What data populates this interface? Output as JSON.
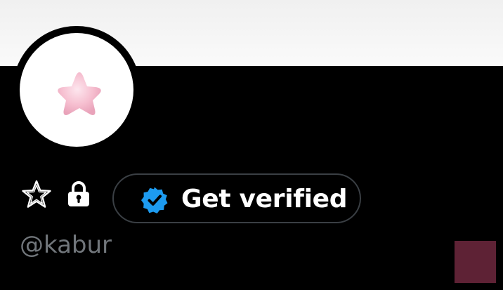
{
  "profile": {
    "handle": "@kabur",
    "verify_button_label": "Get verified"
  },
  "icons": {
    "avatar": "pink-star-avatar",
    "badge_star": "star-outline-icon",
    "protected": "lock-icon",
    "verified": "verified-badge-icon"
  },
  "colors": {
    "background": "#000000",
    "banner": "#f3f3f3",
    "verified_blue": "#1d9bf0",
    "handle_text": "#71767b",
    "button_border": "#3a3f44",
    "swatch": "#5e2235"
  }
}
